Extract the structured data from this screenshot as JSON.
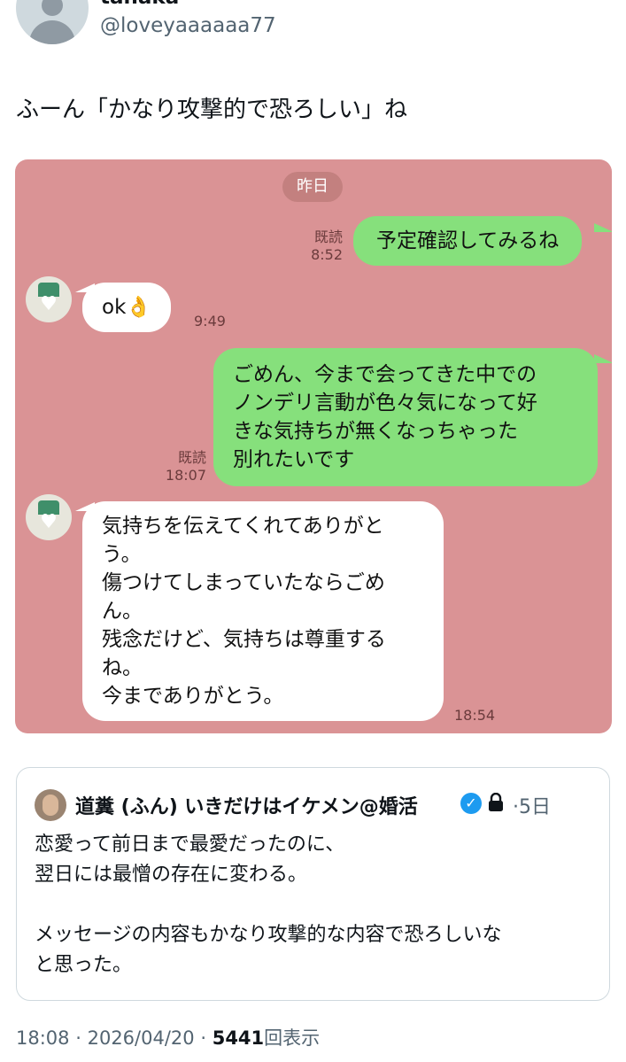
{
  "author": {
    "name": "tanaka",
    "handle": "@loveyaaaaaa77"
  },
  "tweet": {
    "text": "ふーん「かなり攻撃的で恐ろしい」ね"
  },
  "chat": {
    "background_color": "#da9395",
    "date_divider": "昨日",
    "messages": [
      {
        "side": "right",
        "read_label": "既読",
        "time": "8:52",
        "lines": [
          "予定確認してみるね"
        ]
      },
      {
        "side": "left",
        "time": "9:49",
        "lines": [
          "ok👌"
        ]
      },
      {
        "side": "right",
        "read_label": "既読",
        "time": "18:07",
        "lines": [
          "ごめん、今まで会ってきた中での",
          "ノンデリ言動が色々気になって好",
          "きな気持ちが無くなっちゃった",
          "別れたいです"
        ]
      },
      {
        "side": "left",
        "time": "18:54",
        "lines": [
          "気持ちを伝えてくれてありがと",
          "う。",
          "傷つけてしまっていたならごめ",
          "ん。",
          "残念だけど、気持ちは尊重する",
          "ね。",
          "今までありがとう。"
        ]
      }
    ]
  },
  "quoted_tweet": {
    "name": "道糞 (ふん) いきだけはイケメン@婚活",
    "separator": "·",
    "date": "5日",
    "verified_icon": "verified-badge-icon",
    "lock_icon": "lock-icon",
    "lines": [
      "恋愛って前日まで最愛だったのに、",
      "翌日には最憎の存在に変わる。",
      "",
      "メッセージの内容もかなり攻撃的な内容で恐ろしいな",
      "と思った。"
    ]
  },
  "footer": {
    "time": "18:08",
    "separator": "·",
    "date": "2026/04/20",
    "views": "5441",
    "views_label": "回表示"
  }
}
